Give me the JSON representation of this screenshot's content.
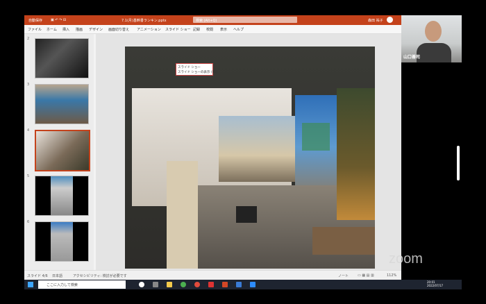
{
  "ppt": {
    "title_left": "自動保存",
    "title_center": "7.1(月)基幹書ランキン.pptx",
    "search_placeholder": "検索 (Alt+Q)",
    "user_name": "森田 祐子",
    "user_initials": "森田",
    "ribbon_tabs": [
      "ファイル",
      "ホーム",
      "挿入",
      "描画",
      "デザイン",
      "画面切り替え",
      "アニメーション",
      "スライド ショー",
      "記録",
      "校閲",
      "表示",
      "ヘルプ"
    ],
    "slide_numbers": [
      "2",
      "3",
      "4",
      "5",
      "6"
    ],
    "popup": {
      "line1": "スライド ショー",
      "line2": "スライド ショーの表示 (F5)"
    },
    "status": {
      "slide": "スライド 4/6",
      "language": "日本語",
      "accessibility": "アクセシビリティ: 検討が必要です",
      "notes": "ノート",
      "zoom": "112%"
    }
  },
  "video": {
    "name": "山口善司"
  },
  "watermark": "zoom",
  "taskbar": {
    "search_placeholder": "ここに入力して検索",
    "time": "20:01",
    "date": "2022/07/17"
  },
  "colors": {
    "ppt_brand": "#c4421b",
    "taskbar": "#1e2430"
  }
}
